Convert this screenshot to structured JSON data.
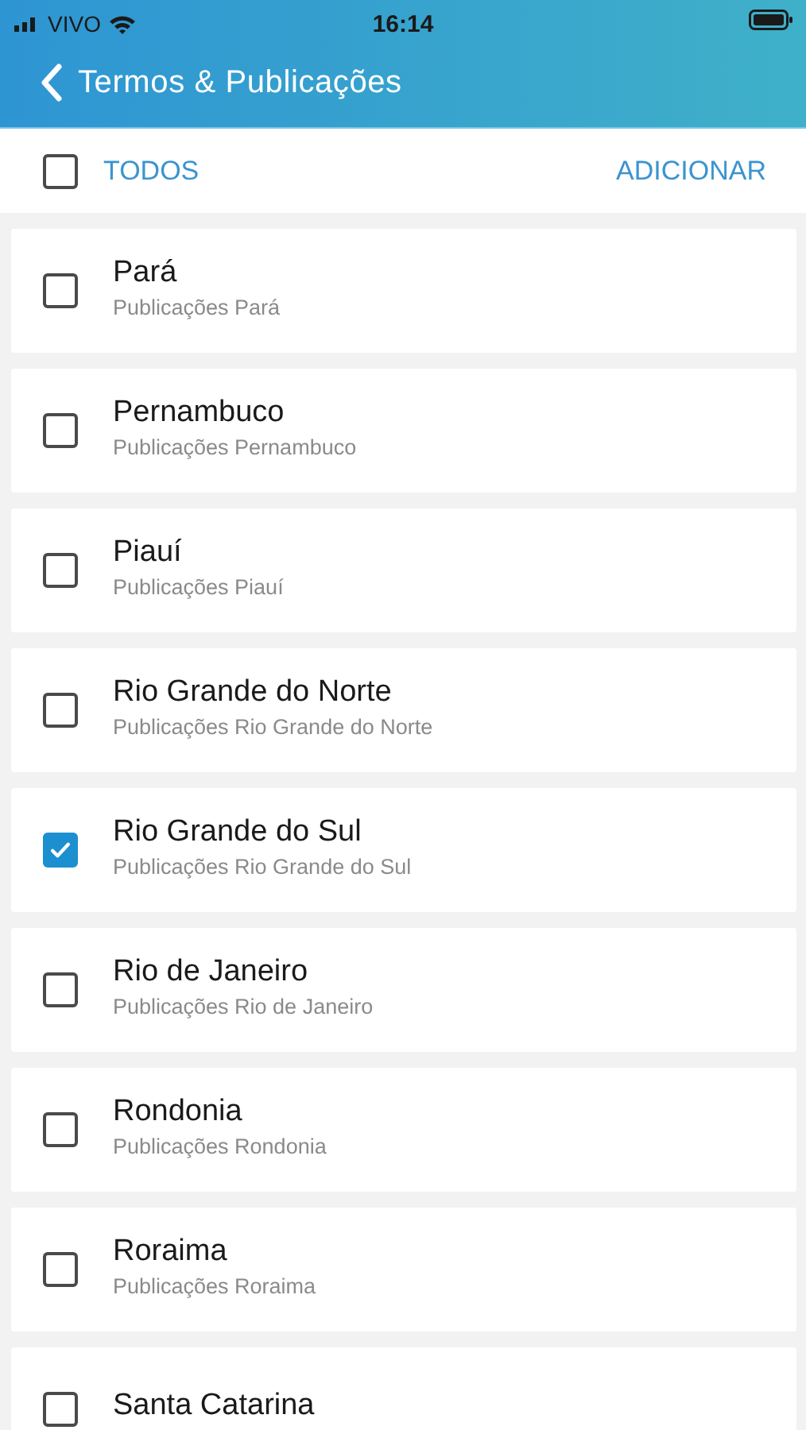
{
  "status_bar": {
    "carrier": "VIVO",
    "time": "16:14"
  },
  "header": {
    "title": "Termos & Publicações"
  },
  "toolbar": {
    "select_all": {
      "label": "TODOS",
      "checked": false
    },
    "add_button": "ADICIONAR"
  },
  "items": [
    {
      "title": "Pará",
      "subtitle": "Publicações Pará",
      "checked": false
    },
    {
      "title": "Pernambuco",
      "subtitle": "Publicações Pernambuco",
      "checked": false
    },
    {
      "title": "Piauí",
      "subtitle": "Publicações Piauí",
      "checked": false
    },
    {
      "title": "Rio Grande do Norte",
      "subtitle": "Publicações Rio Grande do Norte",
      "checked": false
    },
    {
      "title": "Rio Grande do Sul",
      "subtitle": "Publicações Rio Grande do Sul",
      "checked": true
    },
    {
      "title": "Rio de Janeiro",
      "subtitle": "Publicações Rio de Janeiro",
      "checked": false
    },
    {
      "title": "Rondonia",
      "subtitle": "Publicações Rondonia",
      "checked": false
    },
    {
      "title": "Roraima",
      "subtitle": "Publicações Roraima",
      "checked": false
    },
    {
      "title": "Santa Catarina",
      "checked": false
    }
  ]
}
